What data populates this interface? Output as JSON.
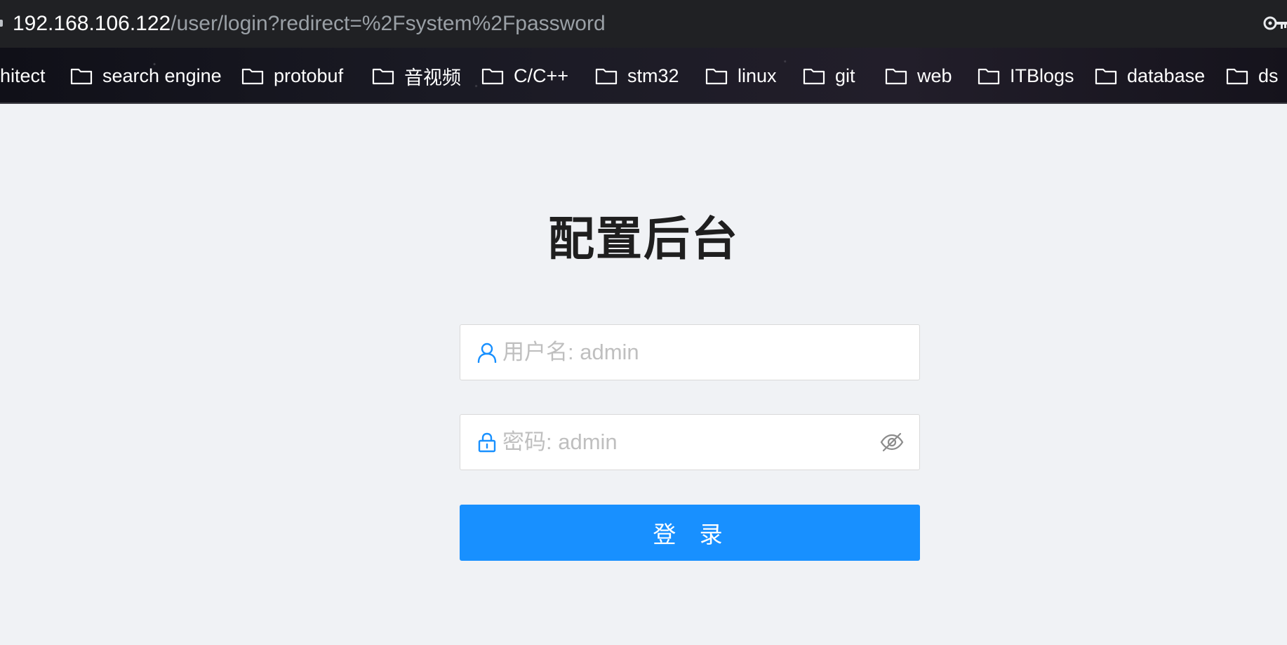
{
  "browser": {
    "url_host": "192.168.106.122",
    "url_path": "/user/login?redirect=%2Fsystem%2Fpassword",
    "right_icon": "key-icon"
  },
  "bookmarks": [
    {
      "label": "hitect",
      "icon": "folder-icon"
    },
    {
      "label": "search engine",
      "icon": "folder-icon"
    },
    {
      "label": "protobuf",
      "icon": "folder-icon"
    },
    {
      "label": "音视频",
      "icon": "folder-icon"
    },
    {
      "label": "C/C++",
      "icon": "folder-icon"
    },
    {
      "label": "stm32",
      "icon": "folder-icon"
    },
    {
      "label": "linux",
      "icon": "folder-icon"
    },
    {
      "label": "git",
      "icon": "folder-icon"
    },
    {
      "label": "web",
      "icon": "folder-icon"
    },
    {
      "label": "ITBlogs",
      "icon": "folder-icon"
    },
    {
      "label": "database",
      "icon": "folder-icon"
    },
    {
      "label": "ds",
      "icon": "folder-icon"
    }
  ],
  "login": {
    "title": "配置后台",
    "username": {
      "placeholder": "用户名: admin",
      "value": "",
      "icon": "user-icon"
    },
    "password": {
      "placeholder": "密码: admin",
      "value": "",
      "icon": "lock-icon",
      "toggle_icon": "eye-invisible-icon"
    },
    "submit_label": "登 录"
  },
  "colors": {
    "primary": "#1890ff",
    "background": "#f0f2f5",
    "address_bar": "#202124"
  }
}
